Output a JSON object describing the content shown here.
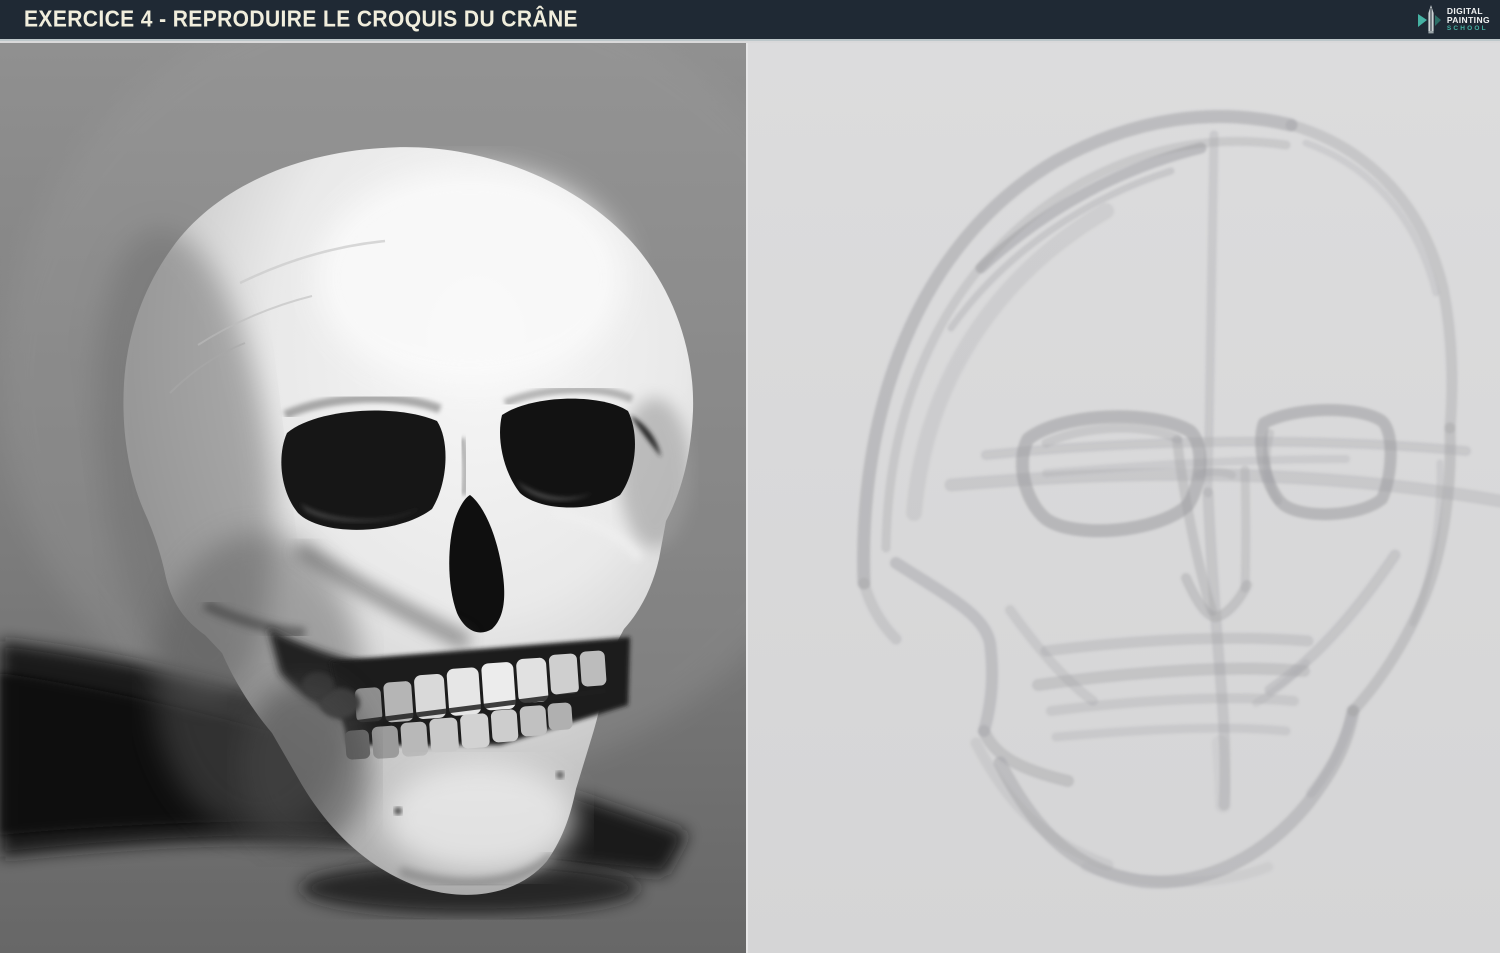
{
  "header": {
    "title": "EXERCICE 4 - REPRODUIRE LE CROQUIS DU CRÂNE",
    "logo": {
      "line1": "DIGITAL",
      "line2": "PAINTING",
      "line3": "SCHOOL"
    }
  },
  "colors": {
    "header_bg": "#1f2934",
    "header_text": "#f1eedd",
    "header_separator": "#bdc7ca",
    "logo_accent": "#45b2a3",
    "logo_text": "#f2f4f4",
    "reference_panel_bg": "#7d7d7d",
    "reference_shadow": "#171717",
    "skull_highlight": "#f6f6f6",
    "canvas_bg": "#d9d9da",
    "sketch_stroke": "#9a9a9f"
  }
}
